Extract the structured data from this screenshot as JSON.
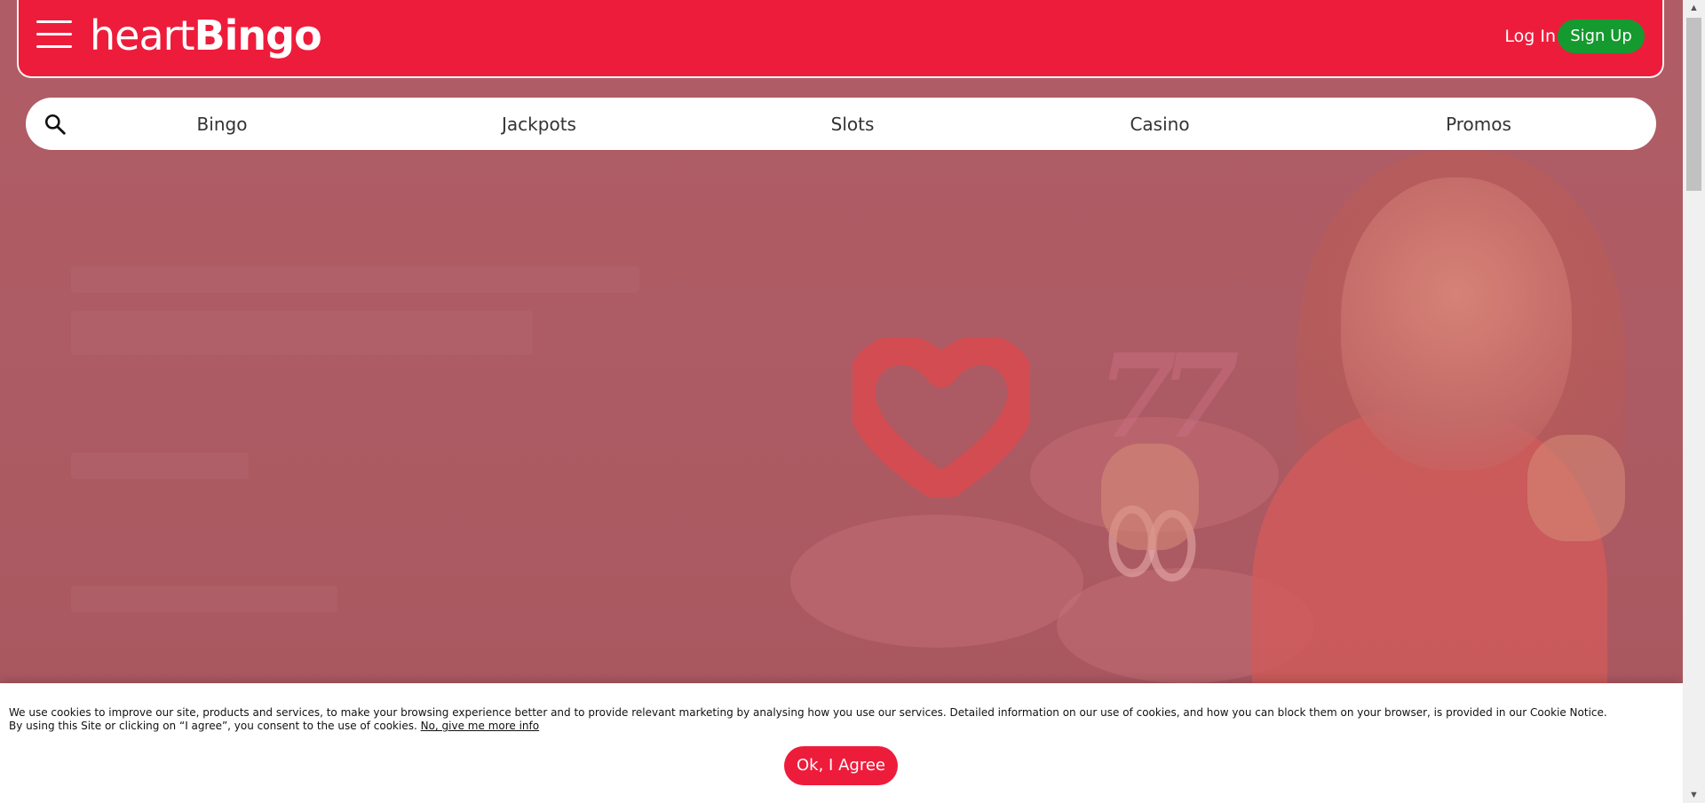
{
  "header": {
    "logo_text_heart": "heart",
    "logo_text_bingo": "Bingo",
    "login_label": "Log In",
    "signup_label": "Sign Up",
    "brand_color": "#ee1c3b",
    "signup_color": "#149a2e"
  },
  "nav": {
    "search_icon": "search-icon",
    "items": [
      {
        "label": "Bingo"
      },
      {
        "label": "Jackpots"
      },
      {
        "label": "Slots"
      },
      {
        "label": "Casino"
      },
      {
        "label": "Promos"
      }
    ]
  },
  "cookie": {
    "line1": "We use cookies to improve our site, products and services, to make your browsing experience better and to provide relevant marketing by analysing how you use our services. Detailed information on our use of cookies, and how you can block them on your browser, is provided in our Cookie Notice.",
    "line2": "By using this Site or clicking on “I agree”, you consent to the use of cookies. ",
    "more_info_link": "No, give me more info",
    "agree_label": "Ok, I Agree"
  }
}
